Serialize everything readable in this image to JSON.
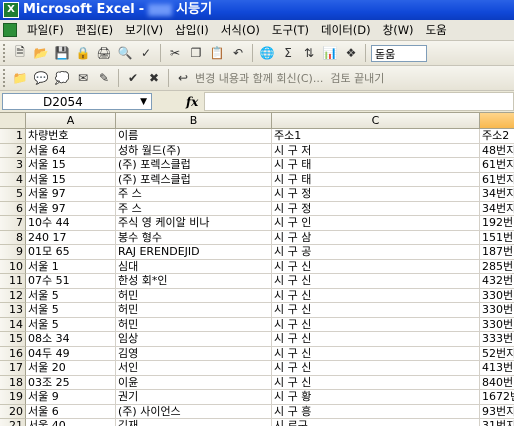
{
  "title": {
    "app": "Microsoft Excel",
    "separator": " - ",
    "doc_visible": "시등기"
  },
  "menu": [
    "파일(F)",
    "편집(E)",
    "보기(V)",
    "삽입(I)",
    "서식(O)",
    "도구(T)",
    "데이터(D)",
    "창(W)",
    "도움"
  ],
  "toolbar1": {
    "font_name": "돋움",
    "icons": [
      "new-icon",
      "open-icon",
      "save-icon",
      "permission-icon",
      "print-icon",
      "preview-icon",
      "spell-icon",
      "cut-icon",
      "copy-icon",
      "paste-icon",
      "undo-icon",
      "hyperlink-icon",
      "sum-icon",
      "sort-icon",
      "chart-icon",
      "zoom-icon"
    ]
  },
  "toolbar2": {
    "review_label": "변경 내용과 함께 회신(C)...",
    "end_label": "검토 끝내기"
  },
  "formula": {
    "name_box": "D2054",
    "fx": "fx",
    "value": ""
  },
  "columns": [
    "A",
    "B",
    "C",
    ""
  ],
  "rows": [
    {
      "n": "1",
      "a": "차량번호",
      "b": "이름",
      "c": "주소1",
      "d": "주소2"
    },
    {
      "n": "2",
      "a": "서울  64",
      "b": "성하    월드(주)",
      "c": "시  구 저",
      "d": "48번지"
    },
    {
      "n": "3",
      "a": "서울  15",
      "b": "(주)    포렉스클럽",
      "c": "시  구 태",
      "d": "61번지"
    },
    {
      "n": "4",
      "a": "서울  15",
      "b": "(주)    포렉스클럽",
      "c": "시  구 태",
      "d": "61번지"
    },
    {
      "n": "5",
      "a": "서울  97",
      "b": "주    스",
      "c": "시  구 정",
      "d": "34번지"
    },
    {
      "n": "6",
      "a": "서울  97",
      "b": "주    스",
      "c": "시  구 정",
      "d": "34번지"
    },
    {
      "n": "7",
      "a": "10수  44",
      "b": "주식  영 케이알 비나",
      "c": "시  구 인",
      "d": "192번"
    },
    {
      "n": "8",
      "a": "240  17",
      "b": "봉수    형수",
      "c": "시  구 삼",
      "d": "151번"
    },
    {
      "n": "9",
      "a": "01모  65",
      "b": "RAJ  ERENDEJID",
      "c": "시  구 공",
      "d": "187번"
    },
    {
      "n": "10",
      "a": "서울  1",
      "b": "심대",
      "c": "시  구 신",
      "d": "285번"
    },
    {
      "n": "11",
      "a": "07수  51",
      "b": "한성    회*인",
      "c": "시  구 신",
      "d": "432번"
    },
    {
      "n": "12",
      "a": "서울  5",
      "b": "허민",
      "c": "시  구 신",
      "d": "330번"
    },
    {
      "n": "13",
      "a": "서울  5",
      "b": "허민",
      "c": "시  구 신",
      "d": "330번"
    },
    {
      "n": "14",
      "a": "서울  5",
      "b": "허민",
      "c": "시  구 신",
      "d": "330번"
    },
    {
      "n": "15",
      "a": "08소  34",
      "b": "임상",
      "c": "시  구 신",
      "d": "333번"
    },
    {
      "n": "16",
      "a": "04두  49",
      "b": "김영",
      "c": "시  구 신",
      "d": "52번지"
    },
    {
      "n": "17",
      "a": "서울  20",
      "b": "서인",
      "c": "시  구 신",
      "d": "413번"
    },
    {
      "n": "18",
      "a": "03조  25",
      "b": "이윤",
      "c": "시  구 신",
      "d": "840번"
    },
    {
      "n": "19",
      "a": "서울  9",
      "b": "권기",
      "c": "시  구 황",
      "d": "1672번"
    },
    {
      "n": "20",
      "a": "서울  6",
      "b": "(주)    사이언스",
      "c": "시  구 흥",
      "d": "93번지"
    },
    {
      "n": "21",
      "a": "서울  40",
      "b": "김재",
      "c": "시  로구",
      "d": "31번지"
    }
  ]
}
